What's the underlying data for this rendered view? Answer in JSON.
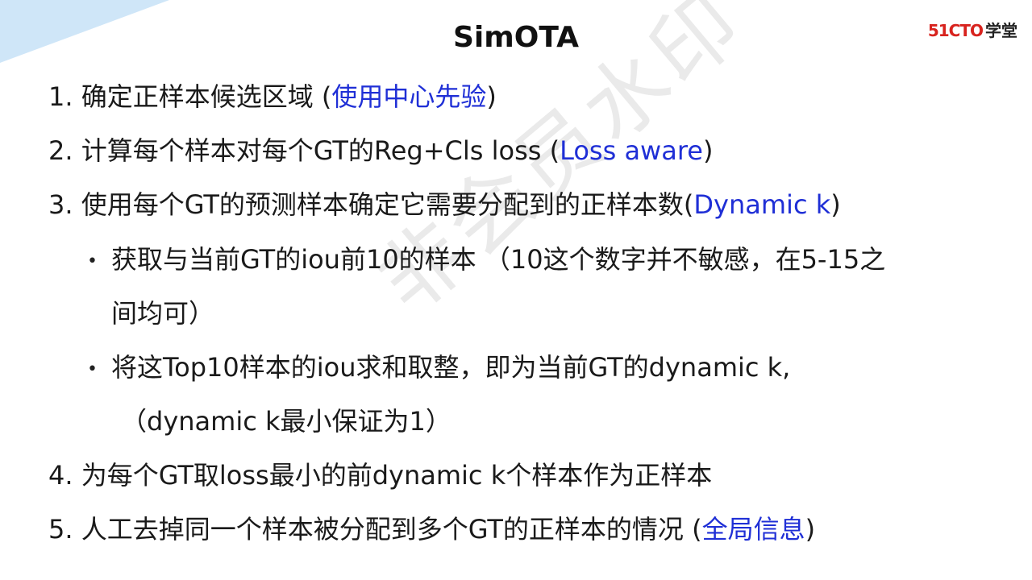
{
  "title": "SimOTA",
  "logo": {
    "brand": "51CTO",
    "sub": "学堂"
  },
  "watermark": "非会员水印",
  "items": [
    {
      "prefix": "1. 确定正样本候选区域 (",
      "highlight": "使用中心先验",
      "suffix": ")"
    },
    {
      "prefix": "2. 计算每个样本对每个GT的Reg+Cls loss (",
      "highlight": "Loss aware",
      "suffix": ")"
    },
    {
      "prefix": "3. 使用每个GT的预测样本确定它需要分配到的正样本数(",
      "highlight": "Dynamic k",
      "suffix": ")"
    },
    {
      "prefix": "4. 为每个GT取loss最小的前dynamic k个样本作为正样本"
    },
    {
      "prefix": "5. 人工去掉同一个样本被分配到多个GT的正样本的情况 (",
      "highlight": "全局信息",
      "suffix": ")"
    }
  ],
  "sub_bullets": [
    {
      "line1": "获取与当前GT的iou前10的样本 （10这个数字并不敏感，在5-15之",
      "line2": "间均可）"
    },
    {
      "line1": "将这Top10样本的iou求和取整，即为当前GT的dynamic k,",
      "line2": "（dynamic k最小保证为1）"
    }
  ],
  "bullet_symbol": "•",
  "colors": {
    "highlight": "#1f2fd6",
    "logo_red": "#d8231e",
    "corner": "#cfe6f8"
  }
}
